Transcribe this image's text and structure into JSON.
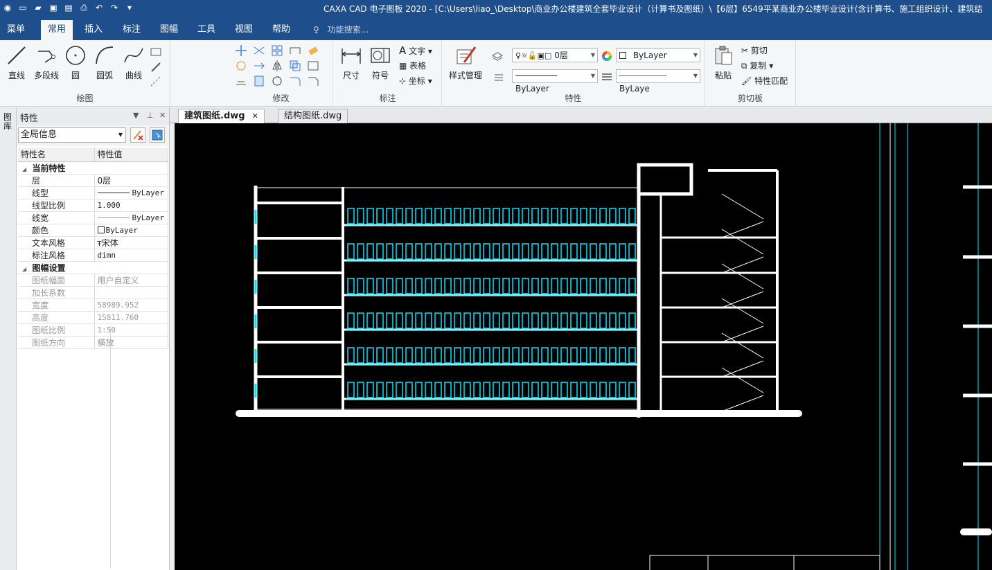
{
  "titlebar": {
    "title": "CAXA CAD 电子图板 2020 - [C:\\Users\\liao_\\Desktop\\商业办公楼建筑全套毕业设计（计算书及图纸）\\【6层】6549平某商业办公楼毕业设计(含计算书、施工组织设计、建筑结"
  },
  "menu": {
    "tabs": [
      {
        "label": "菜单"
      },
      {
        "label": "常用"
      },
      {
        "label": "插入"
      },
      {
        "label": "标注"
      },
      {
        "label": "图幅"
      },
      {
        "label": "工具"
      },
      {
        "label": "视图"
      },
      {
        "label": "帮助"
      }
    ],
    "active_tab": "常用",
    "search_placeholder": "功能搜索..."
  },
  "ribbon": {
    "draw": {
      "title": "绘图",
      "line": "直线",
      "polyline": "多段线",
      "circle": "圆",
      "arc": "圆弧",
      "curve": "曲线"
    },
    "modify": {
      "title": "修改"
    },
    "annotate": {
      "title": "标注",
      "dimension": "尺寸",
      "symbol": "符号",
      "text": "文字",
      "table": "表格",
      "coordinate": "坐标"
    },
    "properties": {
      "title": "特性",
      "style_manager": "样式管理",
      "layer": "0层",
      "color": "ByLayer",
      "linetype": "ByLayer",
      "lineweight": "ByLaye"
    },
    "clipboard": {
      "title": "剪切板",
      "paste": "粘贴",
      "cut": "剪切",
      "copy": "复制",
      "match": "特性匹配"
    }
  },
  "side_strip": {
    "label": "图库"
  },
  "panel": {
    "title": "特性",
    "selector": "全局信息",
    "col_name": "特性名",
    "col_value": "特性值",
    "sections": [
      {
        "title": "当前特性",
        "rows": [
          {
            "name": "层",
            "value": "0层"
          },
          {
            "name": "线型",
            "value": "ByLayer"
          },
          {
            "name": "线型比例",
            "value": "1.000"
          },
          {
            "name": "线宽",
            "value": "ByLayer"
          },
          {
            "name": "颜色",
            "value": "ByLayer"
          },
          {
            "name": "文本风格",
            "value": "宋体"
          },
          {
            "name": "标注风格",
            "value": "dimn"
          }
        ]
      },
      {
        "title": "图幅设置",
        "rows": [
          {
            "name": "图纸幅面",
            "value": "用户自定义"
          },
          {
            "name": "加长系数",
            "value": ""
          },
          {
            "name": "宽度",
            "value": "58989.952"
          },
          {
            "name": "高度",
            "value": "15811.760"
          },
          {
            "name": "图纸比例",
            "value": "1:50"
          },
          {
            "name": "图纸方向",
            "value": "横放"
          }
        ]
      }
    ]
  },
  "doc_tabs": [
    {
      "label": "建筑图纸.dwg",
      "active": true
    },
    {
      "label": "结构图纸.dwg",
      "active": false
    }
  ],
  "colors": {
    "titlebar": "#1e4e8c",
    "canvas": "#000000",
    "cad_white": "#ffffff",
    "cad_cyan": "#00e5ff"
  }
}
